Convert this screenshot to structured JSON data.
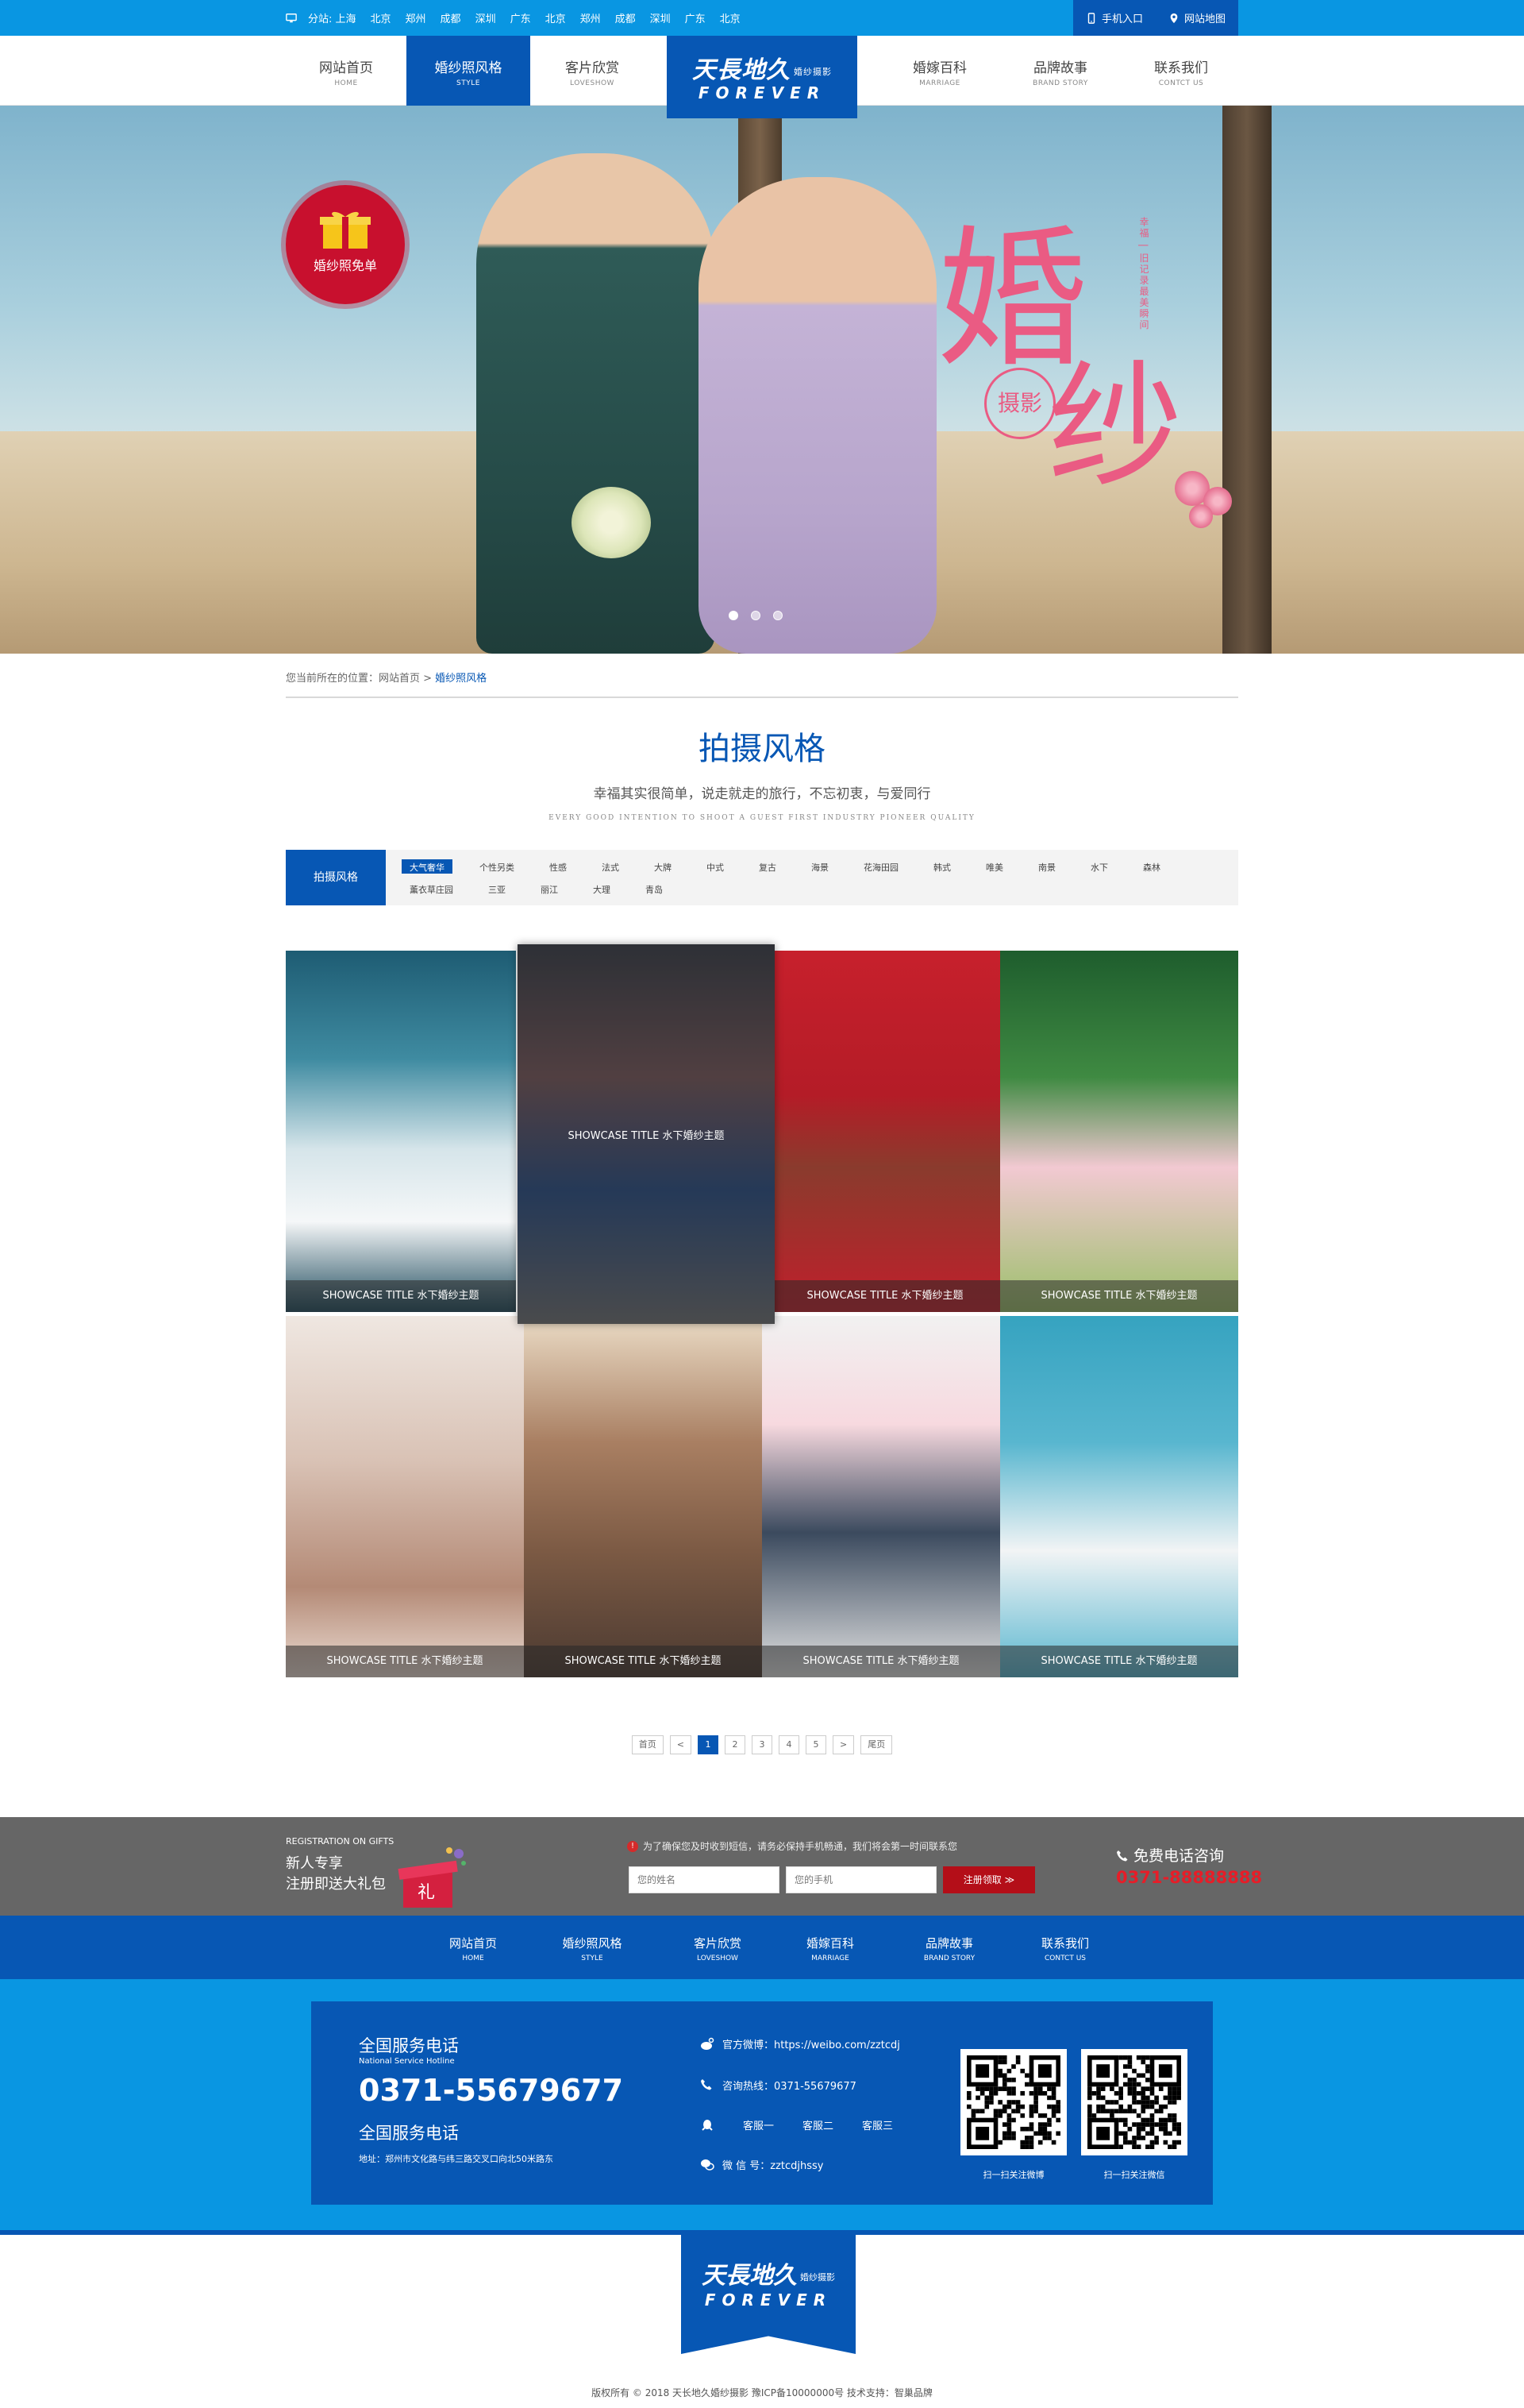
{
  "topbar": {
    "branch_label": "分站: 上海",
    "cities": [
      "北京",
      "郑州",
      "成都",
      "深圳",
      "广东",
      "北京",
      "郑州",
      "成都",
      "深圳",
      "广东",
      "北京"
    ],
    "mobile_label": "手机入口",
    "sitemap_label": "网站地图"
  },
  "nav": {
    "items": [
      {
        "cn": "网站首页",
        "en": "HOME"
      },
      {
        "cn": "婚纱照风格",
        "en": "STYLE"
      },
      {
        "cn": "客片欣赏",
        "en": "LOVESHOW"
      },
      {
        "cn": "婚嫁百科",
        "en": "MARRIAGE"
      },
      {
        "cn": "品牌故事",
        "en": "BRAND STORY"
      },
      {
        "cn": "联系我们",
        "en": "CONTCT US"
      }
    ],
    "active_index": 1
  },
  "logo": {
    "line1": "天長地久",
    "tag": "婚纱摄影",
    "line2": "FOREVER"
  },
  "banner": {
    "badge_text": "婚纱照免单",
    "calligraphy_1": "婚",
    "calligraphy_2": "纱",
    "calligraphy_seal": "摄影",
    "vertical_text": "幸福 | 旧记录最美瞬间",
    "slide_count": 3,
    "active_slide": 0
  },
  "breadcrumb": {
    "prefix": "您当前所在的位置：网站首页 > ",
    "current": "婚纱照风格"
  },
  "section": {
    "title": "拍摄风格",
    "subtitle": "幸福其实很简单，说走就走的旅行，不忘初衷，与爱同行",
    "en": "EVERY GOOD INTENTION TO SHOOT A GUEST FIRST INDUSTRY PIONEER QUALITY"
  },
  "filter": {
    "label": "拍摄风格",
    "tags": [
      "大气奢华",
      "个性另类",
      "性感",
      "法式",
      "大牌",
      "中式",
      "复古",
      "海景",
      "花海田园",
      "韩式",
      "唯美",
      "南景",
      "水下",
      "森林",
      "薰衣草庄园",
      "三亚",
      "丽江",
      "大理",
      "青岛"
    ],
    "active_index": 0
  },
  "gallery": {
    "caption": "SHOWCASE TITLE 水下婚纱主题",
    "items": [
      "SHOWCASE TITLE 水下婚纱主题",
      "SHOWCASE TITLE 水下婚纱主题",
      "SHOWCASE TITLE 水下婚纱主题",
      "SHOWCASE TITLE 水下婚纱主题",
      "SHOWCASE TITLE 水下婚纱主题",
      "SHOWCASE TITLE 水下婚纱主题",
      "SHOWCASE TITLE 水下婚纱主题",
      "SHOWCASE TITLE 水下婚纱主题"
    ],
    "hover_index": 1
  },
  "pager": {
    "first": "首页",
    "prev": "<",
    "pages": [
      "1",
      "2",
      "3",
      "4",
      "5"
    ],
    "next": ">",
    "last": "尾页",
    "current": "1"
  },
  "register": {
    "en": "REGISTRATION ON GIFTS",
    "line1": "新人专享",
    "line2": "注册即送大礼包",
    "notice": "为了确保您及时收到短信，请务必保持手机畅通，我们将会第一时间联系您",
    "name_placeholder": "您的姓名",
    "phone_placeholder": "您的手机",
    "button": "注册领取 ≫",
    "hot_label": "免费电话咨询",
    "hot_number": "0371-88888888"
  },
  "footer_nav": [
    {
      "cn": "网站首页",
      "en": "HOME"
    },
    {
      "cn": "婚纱照风格",
      "en": "STYLE"
    },
    {
      "cn": "客片欣赏",
      "en": "LOVESHOW"
    },
    {
      "cn": "婚嫁百科",
      "en": "MARRIAGE"
    },
    {
      "cn": "品牌故事",
      "en": "BRAND STORY"
    },
    {
      "cn": "联系我们",
      "en": "CONTCT US"
    }
  ],
  "footer_info": {
    "service_title": "全国服务电话",
    "service_en": "National Service Hotline",
    "hotline": "0371-55679677",
    "service_title2": "全国服务电话",
    "address": "地址：郑州市文化路与纬三路交叉口向北50米路东",
    "weibo": "官方微博：https://weibo.com/zztcdj",
    "phone": "咨询热线：0371-55679677",
    "qq": [
      "客服一",
      "客服二",
      "客服三"
    ],
    "wechat": "微 信 号：zztcdjhssy",
    "qr1_caption": "扫一扫关注微博",
    "qr2_caption": "扫一扫关注微信"
  },
  "copyright": "版权所有 © 2018 天长地久婚纱摄影   豫ICP备10000000号   技术支持：智巢品牌",
  "colors": {
    "primary": "#0757b4",
    "accent": "#0996e2",
    "red": "#b40e18",
    "pink": "#ea5b83"
  }
}
